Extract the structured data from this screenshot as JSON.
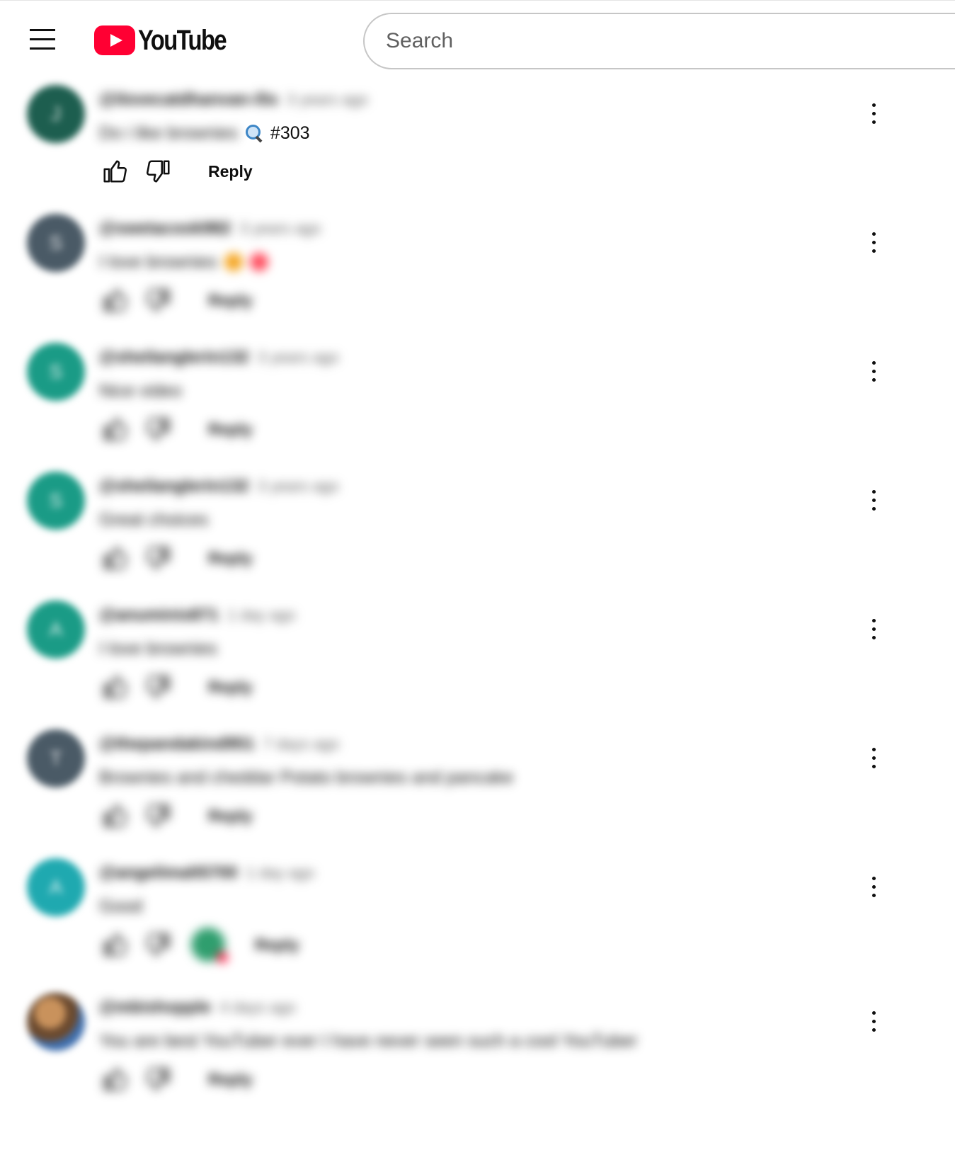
{
  "header": {
    "logo_text": "YouTube",
    "search_placeholder": "Search"
  },
  "comments": [
    {
      "author": "@ilovecatdhanvan-i5s",
      "time": "3 years ago",
      "text_blurred": "Do i like brownies",
      "hashtag": "#303",
      "reply_label": "Reply",
      "avatar_color": "#1d5e4f",
      "avatar_letter": "J"
    },
    {
      "author": "@swetacook982",
      "time": "3 years ago",
      "text": "I love brownies",
      "reply_label": "Reply",
      "avatar_color": "#4a5a66",
      "avatar_letter": "S",
      "emojis": [
        "#f5a623",
        "#ff4d5e"
      ]
    },
    {
      "author": "@sheilanglerin132",
      "time": "3 years ago",
      "text": "Nice video",
      "reply_label": "Reply",
      "avatar_color": "#1a9b86",
      "avatar_letter": "S"
    },
    {
      "author": "@sheilanglerin132",
      "time": "3 years ago",
      "text": "Great choices",
      "reply_label": "Reply",
      "avatar_color": "#1a9b86",
      "avatar_letter": "S"
    },
    {
      "author": "@anuminis871",
      "time": "1 day ago",
      "text": "I love brownies",
      "reply_label": "Reply",
      "avatar_color": "#1a9b86",
      "avatar_letter": "A"
    },
    {
      "author": "@thepandakind951",
      "time": "7 days ago",
      "text": "Brownies and cheddar Potato brownies and pancake",
      "reply_label": "Reply",
      "avatar_color": "#4a5a66",
      "avatar_letter": "T"
    },
    {
      "author": "@angelimalt5700",
      "time": "1 day ago",
      "text": "Good",
      "reply_label": "Reply",
      "avatar_color": "#1fa9b0",
      "avatar_letter": "A",
      "creator_heart": true
    },
    {
      "author": "@mbishopple",
      "time": "4 days ago",
      "text": "You are best YouTuber ever I have never seen such a cool YouTuber",
      "reply_label": "Reply",
      "avatar_color": "#8a6a48",
      "avatar_letter": "",
      "photo_avatar": true
    }
  ]
}
